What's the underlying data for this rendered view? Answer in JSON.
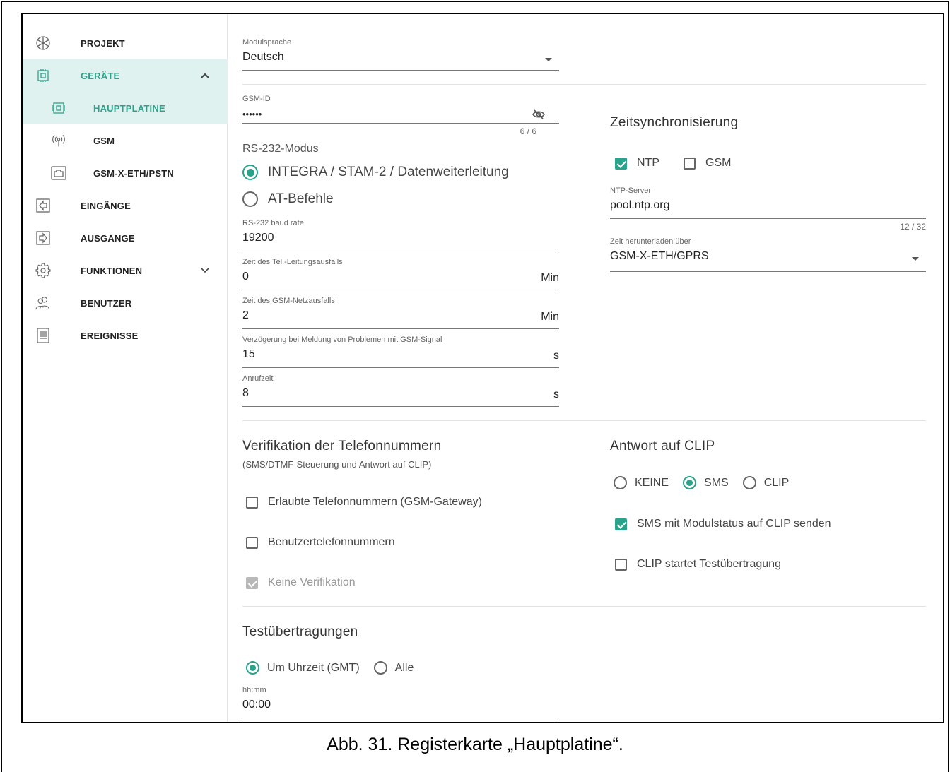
{
  "sidebar": {
    "items": [
      {
        "label": "PROJEKT"
      },
      {
        "label": "GERÄTE"
      },
      {
        "label": "HAUPTPLATINE"
      },
      {
        "label": "GSM"
      },
      {
        "label": "GSM-X-ETH/PSTN"
      },
      {
        "label": "EINGÄNGE"
      },
      {
        "label": "AUSGÄNGE"
      },
      {
        "label": "FUNKTIONEN"
      },
      {
        "label": "BENUTZER"
      },
      {
        "label": "EREIGNISSE"
      }
    ]
  },
  "module_language": {
    "label": "Modulsprache",
    "value": "Deutsch"
  },
  "gsm_id": {
    "label": "GSM-ID",
    "value": "••••••",
    "counter": "6 / 6"
  },
  "rs232_mode": {
    "label": "RS-232-Modus",
    "options": [
      "INTEGRA / STAM-2 / Datenweiterleitung",
      "AT-Befehle"
    ],
    "selected": "INTEGRA / STAM-2 / Datenweiterleitung"
  },
  "baud_rate": {
    "label": "RS-232 baud rate",
    "value": "19200"
  },
  "line_failure": {
    "label": "Zeit des Tel.-Leitungsausfalls",
    "value": "0",
    "unit": "Min"
  },
  "gsm_failure": {
    "label": "Zeit des GSM-Netzausfalls",
    "value": "2",
    "unit": "Min"
  },
  "gsm_signal_delay": {
    "label": "Verzögerung bei Meldung von Problemen mit GSM-Signal",
    "value": "15",
    "unit": "s"
  },
  "call_time": {
    "label": "Anrufzeit",
    "value": "8",
    "unit": "s"
  },
  "time_sync": {
    "title": "Zeitsynchronisierung",
    "ntp": {
      "label": "NTP",
      "checked": true
    },
    "gsm": {
      "label": "GSM",
      "checked": false
    },
    "ntp_server": {
      "label": "NTP-Server",
      "value": "pool.ntp.org",
      "counter": "12 / 32"
    },
    "download_via": {
      "label": "Zeit herunterladen über",
      "value": "GSM-X-ETH/GPRS"
    }
  },
  "verification": {
    "title": "Verifikation der Telefonnummern",
    "subtitle": "(SMS/DTMF-Steuerung und Antwort auf CLIP)",
    "allowed_numbers": {
      "label": "Erlaubte Telefonnummern (GSM-Gateway)",
      "checked": false
    },
    "user_numbers": {
      "label": "Benutzertelefonnummern",
      "checked": false
    },
    "no_verification": {
      "label": "Keine Verifikation",
      "checked": true,
      "disabled": true
    }
  },
  "clip_response": {
    "title": "Antwort auf CLIP",
    "options": [
      "KEINE",
      "SMS",
      "CLIP"
    ],
    "selected": "SMS",
    "send_status": {
      "label": "SMS mit Modulstatus auf CLIP senden",
      "checked": true
    },
    "test_transmission": {
      "label": "CLIP startet Testübertragung",
      "checked": false
    }
  },
  "test_transmissions": {
    "title": "Testübertragungen",
    "options": [
      "Um Uhrzeit (GMT)",
      "Alle"
    ],
    "selected": "Um Uhrzeit (GMT)",
    "time": {
      "label": "hh:mm",
      "value": "00:00"
    }
  },
  "caption": "Abb. 31. Registerkarte „Hauptplatine“.",
  "colors": {
    "accent": "#2aa38c",
    "active_bg": "#e0f2ef"
  }
}
